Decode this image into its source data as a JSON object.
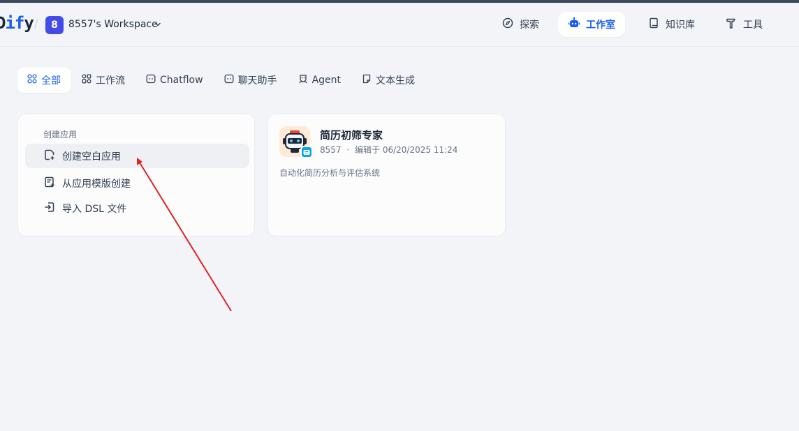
{
  "header": {
    "logo_prefix": "D",
    "logo_i": "i",
    "logo_f": "f",
    "logo_y": "y",
    "separator": "/",
    "workspace_initial": "8",
    "workspace_name": "8557's Workspace",
    "nav": [
      {
        "label": "探索",
        "icon": "compass-icon",
        "active": false
      },
      {
        "label": "工作室",
        "icon": "robot-icon",
        "active": true
      },
      {
        "label": "知识库",
        "icon": "book-icon",
        "active": false
      },
      {
        "label": "工具",
        "icon": "hammer-icon",
        "active": false
      }
    ]
  },
  "tabs": [
    {
      "label": "全部",
      "icon": "grid-icon",
      "active": true
    },
    {
      "label": "工作流",
      "icon": "workflow-icon",
      "active": false
    },
    {
      "label": "Chatflow",
      "icon": "chatflow-icon",
      "active": false
    },
    {
      "label": "聊天助手",
      "icon": "chat-icon",
      "active": false
    },
    {
      "label": "Agent",
      "icon": "agent-icon",
      "active": false
    },
    {
      "label": "文本生成",
      "icon": "document-icon",
      "active": false
    }
  ],
  "create": {
    "title": "创建应用",
    "items": [
      {
        "label": "创建空白应用",
        "icon": "new-file-icon"
      },
      {
        "label": "从应用模版创建",
        "icon": "template-icon"
      },
      {
        "label": "导入 DSL 文件",
        "icon": "import-icon"
      }
    ]
  },
  "app": {
    "name": "简历初筛专家",
    "author": "8557",
    "dot": "·",
    "edited": "编辑于 06/20/2025 11:24",
    "description": "自动化简历分析与评估系统",
    "icon": "robot-avatar-icon",
    "badge_icon": "chat-bubble-icon"
  },
  "colors": {
    "accent": "#155eef",
    "annotation_arrow": "#e02424"
  }
}
